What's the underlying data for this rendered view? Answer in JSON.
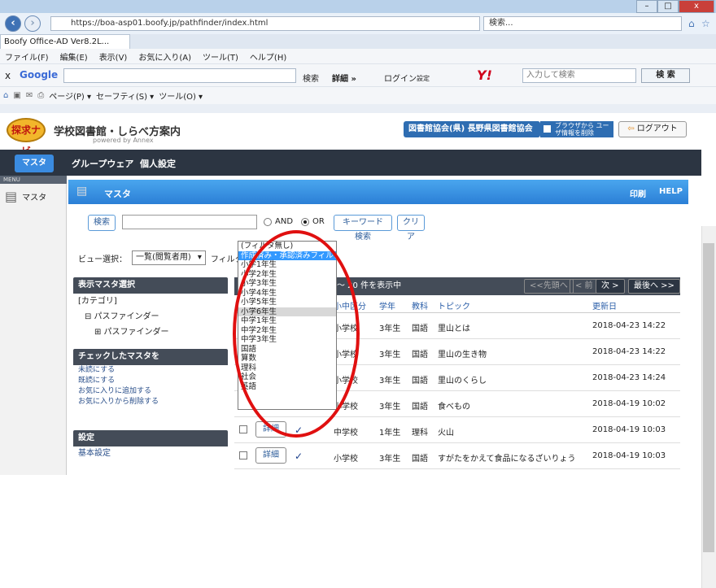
{
  "window": {
    "min": "–",
    "max": "□",
    "close": "x"
  },
  "browser": {
    "url": "https://boa-asp01.boofy.jp/pathfinder/index.html",
    "search_placeholder": "検索...",
    "tab_title": "Boofy Office-AD Ver8.2L...",
    "menu": [
      "ファイル(F)",
      "編集(E)",
      "表示(V)",
      "お気に入り(A)",
      "ツール(T)",
      "ヘルプ(H)"
    ],
    "google_label": "Google",
    "google_search": "検索",
    "details": "詳細 »",
    "login": "ログイン",
    "settings": "設定",
    "yahoo_placeholder": "入力して検索",
    "yahoo_search": "検 索",
    "cmd": [
      "ページ(P) ▾",
      "セーフティ(S) ▾",
      "ツール(O) ▾"
    ]
  },
  "app": {
    "logo_text": "探求ナビ",
    "name": "学校図書館・しらべ方案内",
    "powered": "powered by Annex",
    "library": "図書館協会(県) 長野県図書館協会",
    "cookie_text": "ブラウザから ユーザ情報を削除",
    "logout": "ログアウト",
    "nav": [
      "マスタ",
      "グループウェア",
      "個人設定"
    ],
    "menu_tag": "MENU",
    "left_master": "マスタ",
    "banner_title": "マスタ",
    "print": "印刷",
    "help": "HELP"
  },
  "search": {
    "button": "検索",
    "value": "",
    "and": "AND",
    "or": "OR",
    "keyword_btn": "キーワード検索",
    "clear": "クリア"
  },
  "view": {
    "label": "ビュー選択：",
    "selected": "一覧(閲覧者用)",
    "filter_label": "フィルタ選択"
  },
  "left_panel": {
    "master_select": "表示マスタ選択",
    "category": "[カテゴリ]",
    "pf_root": "⊟ パスファインダー",
    "pf_child": "⊞ パスファインダー",
    "checked": "チェックしたマスタを",
    "actions": [
      "未読にする",
      "既読にする",
      "お気に入りに追加する",
      "お気に入りから削除する"
    ],
    "settings": "設定",
    "basic": "基本設定"
  },
  "pager": {
    "info": "～ 20 件を表示中",
    "first": "<<先頭へ",
    "prev": "< 前",
    "next": "次 >",
    "last": "最後へ >>"
  },
  "columns": [
    "小中区分",
    "学年",
    "教科",
    "トピック",
    "更新日"
  ],
  "rows": [
    {
      "school": "小学校",
      "grade": "3年生",
      "subject": "国語",
      "topic": "里山とは",
      "date": "2018-04-23 14:22"
    },
    {
      "school": "小学校",
      "grade": "3年生",
      "subject": "国語",
      "topic": "里山の生き物",
      "date": "2018-04-23 14:22"
    },
    {
      "school": "小学校",
      "grade": "3年生",
      "subject": "国語",
      "topic": "里山のくらし",
      "date": "2018-04-23 14:24"
    },
    {
      "school": "小学校",
      "grade": "3年生",
      "subject": "国語",
      "topic": "食べもの",
      "date": "2018-04-19 10:02"
    },
    {
      "school": "中学校",
      "grade": "1年生",
      "subject": "理科",
      "topic": "火山",
      "date": "2018-04-19 10:03",
      "detail": "詳細",
      "check": "✓"
    },
    {
      "school": "小学校",
      "grade": "3年生",
      "subject": "国語",
      "topic": "すがたをかえて食品になるざいりょう",
      "date": "2018-04-19 10:03",
      "detail": "詳細",
      "check": "✓"
    }
  ],
  "dropdown": {
    "options": [
      "(フィルタ無し)",
      "作成済み・承認済みフィルタ",
      "小学1年生",
      "小学2年生",
      "小学3年生",
      "小学4年生",
      "小学5年生",
      "小学6年生",
      "中学1年生",
      "中学2年生",
      "中学3年生",
      "国語",
      "算数",
      "理科",
      "社会",
      "英語"
    ],
    "selected_index": 1,
    "hover_index": 7
  },
  "colors": {
    "accent": "#2e6db2",
    "nav_dark": "#2c3542",
    "banner": "#3a90e0",
    "highlight": "#3399ff",
    "annotation": "#e01010"
  }
}
